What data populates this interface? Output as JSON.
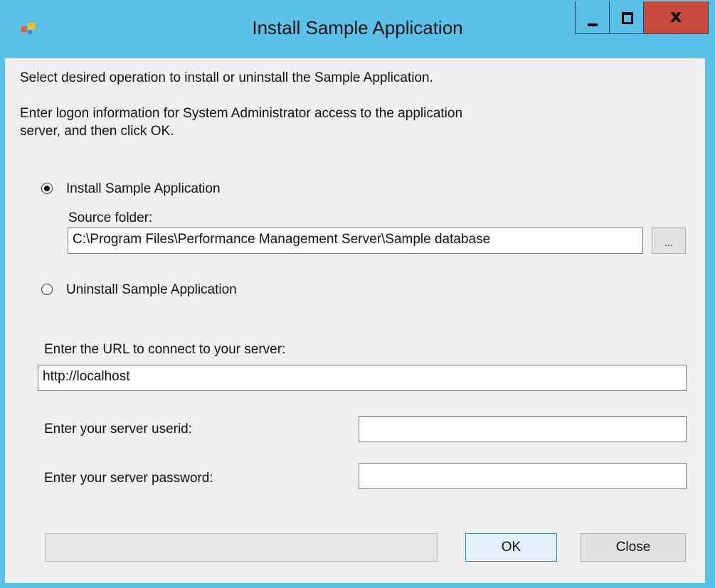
{
  "window": {
    "title": "Install Sample Application",
    "icon": "application-icon",
    "close_label": "x"
  },
  "instructions": {
    "line1": "Select desired operation to install or uninstall the Sample Application.",
    "line2a": "Enter logon information for System Administrator access to the application",
    "line2b": "server, and then click OK."
  },
  "install_option": {
    "label": "Install Sample Application",
    "selected": true,
    "source_folder_label": "Source folder:",
    "source_folder_value": "C:\\Program Files\\Performance Management Server\\Sample database",
    "browse_label": "..."
  },
  "uninstall_option": {
    "label": "Uninstall Sample Application",
    "selected": false
  },
  "server": {
    "url_label": "Enter the URL to connect to your server:",
    "url_value": "http://localhost",
    "userid_label": "Enter your server userid:",
    "userid_value": "",
    "password_label": "Enter your server password:",
    "password_value": ""
  },
  "progress": {
    "percent": 0
  },
  "buttons": {
    "ok": "OK",
    "close": "Close"
  },
  "colors": {
    "titlebar": "#5ac2e7",
    "close_button": "#c94b3c",
    "client_bg": "#f0f0f0"
  }
}
